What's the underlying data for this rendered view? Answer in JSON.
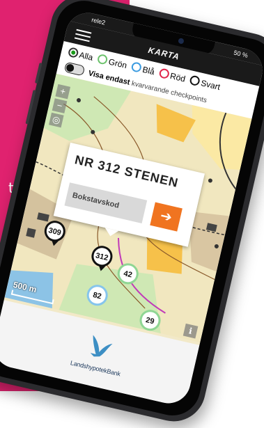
{
  "side_text": "tt",
  "status": {
    "carrier": "rele2",
    "battery": "50 %"
  },
  "header": {
    "title": "KARTA"
  },
  "filters": {
    "options": [
      {
        "label": "Alla",
        "color": "#1a9a1a",
        "selected": true
      },
      {
        "label": "Grön",
        "color": "#6cc26c",
        "selected": false
      },
      {
        "label": "Blå",
        "color": "#3b9be0",
        "selected": false
      },
      {
        "label": "Röd",
        "color": "#e0244a",
        "selected": false
      },
      {
        "label": "Svart",
        "color": "#111111",
        "selected": false
      }
    ],
    "toggle_bold": "Visa endast",
    "toggle_rest": "kvarvarande checkpoints"
  },
  "map": {
    "zoom_in": "+",
    "zoom_out": "−",
    "popup": {
      "title": "NR 312 STENEN",
      "input_placeholder": "Bokstavskod",
      "go_label": "➔"
    },
    "markers": [
      {
        "label": "309",
        "style": "black"
      },
      {
        "label": "312",
        "style": "black"
      },
      {
        "label": "42",
        "style": "green"
      },
      {
        "label": "82",
        "style": "blue"
      },
      {
        "label": "29",
        "style": "green"
      }
    ],
    "scale": "500 m",
    "info": "i"
  },
  "footer": {
    "logo_text": "LandshypotekBank"
  },
  "colors": {
    "brand_pink": "#e0226f",
    "accent_orange": "#f07420"
  }
}
